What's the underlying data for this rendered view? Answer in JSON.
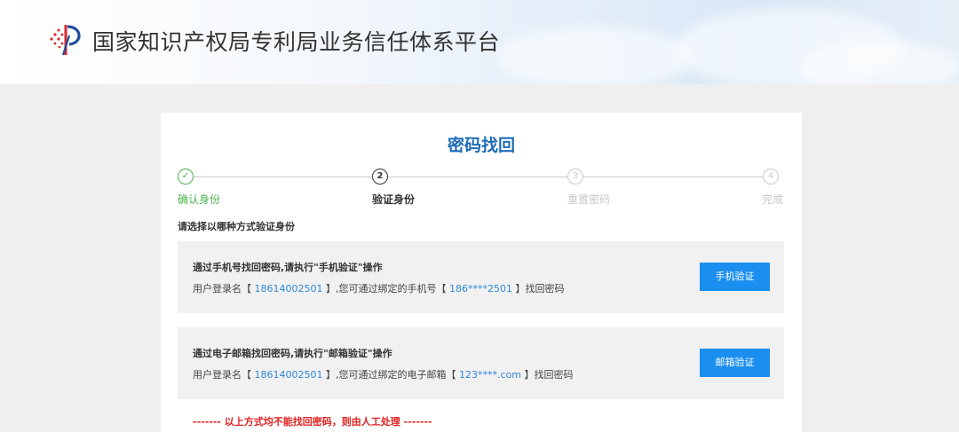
{
  "header": {
    "site_title": "国家知识产权局专利局业务信任体系平台"
  },
  "card": {
    "title": "密码找回",
    "steps": [
      {
        "number": "✓",
        "label": "确认身份",
        "state": "done"
      },
      {
        "number": "2",
        "label": "验证身份",
        "state": "active"
      },
      {
        "number": "3",
        "label": "重置密码",
        "state": "pending"
      },
      {
        "number": "4",
        "label": "完成",
        "state": "pending"
      }
    ],
    "prompt": "请选择以哪种方式验证身份",
    "phone_option": {
      "title": "通过手机号找回密码,请执行\"手机验证\"操作",
      "desc_prefix": "用户登录名【",
      "username": "18614002501",
      "desc_middle": "】,您可通过绑定的手机号【",
      "masked_value": "186****2501",
      "desc_suffix": "】找回密码",
      "button_label": "手机验证"
    },
    "email_option": {
      "title": "通过电子邮箱找回密码,请执行\"邮箱验证\"操作",
      "desc_prefix": "用户登录名【",
      "username": "18614002501",
      "desc_middle": "】,您可通过绑定的电子邮箱【",
      "masked_value": "123****.com",
      "desc_suffix": "】找回密码",
      "button_label": "邮箱验证"
    },
    "manual_note": "------- 以上方式均不能找回密码，则由人工处理 -------"
  },
  "colors": {
    "accent_blue": "#1b8ff0",
    "title_blue": "#1f6cb5",
    "done_green": "#4cb34c",
    "alert_red": "#e02020"
  }
}
